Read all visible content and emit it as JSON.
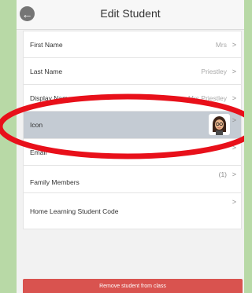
{
  "header": {
    "title": "Edit Student",
    "back_icon": "back-arrow-icon"
  },
  "rows": [
    {
      "label": "First Name",
      "value": "Mrs",
      "chevron": ">"
    },
    {
      "label": "Last Name",
      "value": "Priestley",
      "chevron": ">"
    },
    {
      "label": "Display Name",
      "value": "Mrs Priestley",
      "chevron": ">"
    },
    {
      "label": "Icon",
      "chevron": ">"
    },
    {
      "label": "Email",
      "chevron": ">"
    },
    {
      "label": "Family Members",
      "value": "(1)",
      "chevron": ">"
    },
    {
      "label": "Home Learning Student Code",
      "chevron": ">"
    }
  ],
  "remove_button": {
    "label": "Remove student from class"
  },
  "colors": {
    "background": "#b8d9a6",
    "selected_row": "#c4cbd3",
    "danger": "#d9534f",
    "annotation": "#e8101a"
  }
}
